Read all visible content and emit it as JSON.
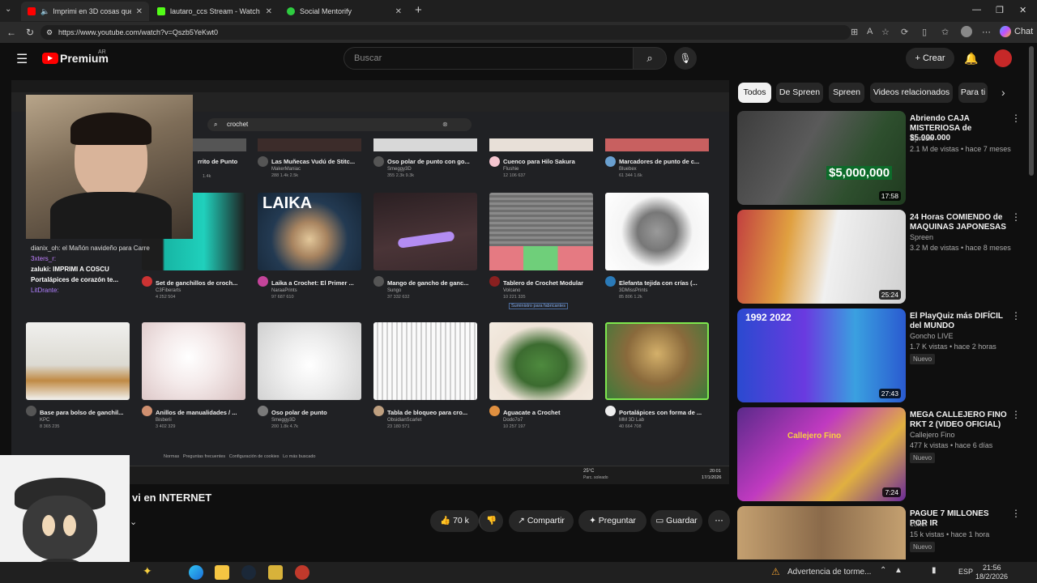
{
  "browser": {
    "tabs": [
      {
        "title": "Imprimi en 3D cosas que vi en",
        "active": true
      },
      {
        "title": "lautaro_ccs Stream - Watch Live o",
        "active": false
      },
      {
        "title": "Social Mentorify",
        "active": false
      }
    ],
    "url": "https://www.youtube.com/watch?v=Qszb5YeKwt0",
    "chat_label": "Chat"
  },
  "youtube": {
    "logo": "Premium",
    "region": "AR",
    "search_placeholder": "Buscar",
    "create_label": "Crear"
  },
  "video": {
    "inner_search": "crochet",
    "row1": [
      {
        "title": "rrito de Punto",
        "author": "",
        "stats": "1.4k"
      },
      {
        "title": "Las Muñecas Vudú de Stitc...",
        "author": "MakerManiac",
        "stats": "288 1.4k 2.5k"
      },
      {
        "title": "Oso polar de punto con go...",
        "author": "Smeggy3D",
        "stats": "355 2.3k 9.3k"
      },
      {
        "title": "Cuenco para Hilo Sakura",
        "author": "Flushie",
        "stats": "12 106 637"
      },
      {
        "title": "Marcadores de punto de c...",
        "author": "Bluebex",
        "stats": "61 344 1.6k"
      }
    ],
    "row2": [
      {
        "title": "Set de ganchillos de croch...",
        "author": "C3Fiberarts",
        "stats": "4 252 504"
      },
      {
        "title": "Laika a Crochet: El Primer ...",
        "author": "NaraaPrints",
        "stats": "97 687 610"
      },
      {
        "title": "Mango de gancho de ganc...",
        "author": "Sungo",
        "stats": "37 332 632"
      },
      {
        "title": "Tablero de Crochet Modular",
        "author": "Volcano",
        "stats": "10 221 335"
      },
      {
        "title": "Elefanta tejida con crías (...",
        "author": "3DMissPrints",
        "stats": "85 806 1.2k"
      }
    ],
    "row3": [
      {
        "title": "Base para bolso de ganchil...",
        "author": "KPC",
        "stats": "8 365 235"
      },
      {
        "title": "Anillos de manualidades / ...",
        "author": "Bisberii",
        "stats": "3 402 329"
      },
      {
        "title": "Oso polar de punto",
        "author": "Smeggy3D",
        "stats": "200 1.8k 4.7k"
      },
      {
        "title": "Tabla de bloqueo para cro...",
        "author": "ObsidianScarlet",
        "stats": "23 180 571"
      },
      {
        "title": "Aguacate a Crochet",
        "author": "Dodo7o7",
        "stats": "10 257 197"
      },
      {
        "title": "Portalápices con forma de ...",
        "author": "MM 3D Lab",
        "stats": "40 664 708"
      }
    ],
    "supplier_badge": "Suministro para fabricantes",
    "laika_text": "LAIKA",
    "chat_lines": [
      "dianix_oh: el Mañón navideño para Carre",
      "3xters_r:",
      "zaluki: IMPRIMI A COSCU",
      "Portalápices de corazón te...",
      "LitDrante:"
    ],
    "footer_links": [
      "Normas",
      "Preguntas frecuentes",
      "Configuración de cookies",
      "Lo más buscado"
    ],
    "weather": "25°C",
    "weather_sub": "Parc. soleado",
    "clock_time": "20:01",
    "clock_date": "17/1/2026"
  },
  "title": "vi en INTERNET",
  "actions": {
    "likes": "70 k",
    "share": "Compartir",
    "ask": "Preguntar",
    "save": "Guardar"
  },
  "chips": [
    "Todos",
    "De Spreen",
    "Spreen",
    "Videos relacionados",
    "Para ti"
  ],
  "recommendations": [
    {
      "title": "Abriendo CAJA MISTERIOSA de $5.000.000",
      "channel": "Spreen",
      "meta": "2.1 M de vistas • hace 7 meses",
      "duration": "17:58",
      "thumb_text": "$5,000,000",
      "badge": ""
    },
    {
      "title": "24 Horas COMIENDO de MAQUINAS JAPONESAS",
      "channel": "Spreen",
      "meta": "3.2 M de vistas • hace 8 meses",
      "duration": "25:24",
      "thumb_text": "",
      "badge": ""
    },
    {
      "title": "El PlayQuiz más DIFÍCIL del MUNDO",
      "channel": "Goncho LIVE",
      "meta": "1.7 K vistas • hace 2 horas",
      "duration": "27:43",
      "thumb_text": "1992  2022",
      "badge": "Nuevo"
    },
    {
      "title": "MEGA CALLEJERO FINO RKT 2 (VIDEO OFICIAL)",
      "channel": "Callejero Fino",
      "meta": "477 k vistas • hace 6 días",
      "duration": "7:24",
      "thumb_text": "Callejero Fino",
      "badge": "Nuevo"
    },
    {
      "title": "PAGUE 7 MILLONES POR IR",
      "channel": "c0ker",
      "meta": "15 k vistas • hace 1 hora",
      "duration": "",
      "thumb_text": "",
      "badge": "Nuevo"
    }
  ],
  "taskbar": {
    "notification": "Advertencia de torme...",
    "lang": "ESP",
    "time": "21:56",
    "date": "18/2/2026"
  },
  "colors": {
    "bg": "#0f0f0f",
    "yt_red": "#ff0000",
    "accent_green": "#2ecc40"
  }
}
